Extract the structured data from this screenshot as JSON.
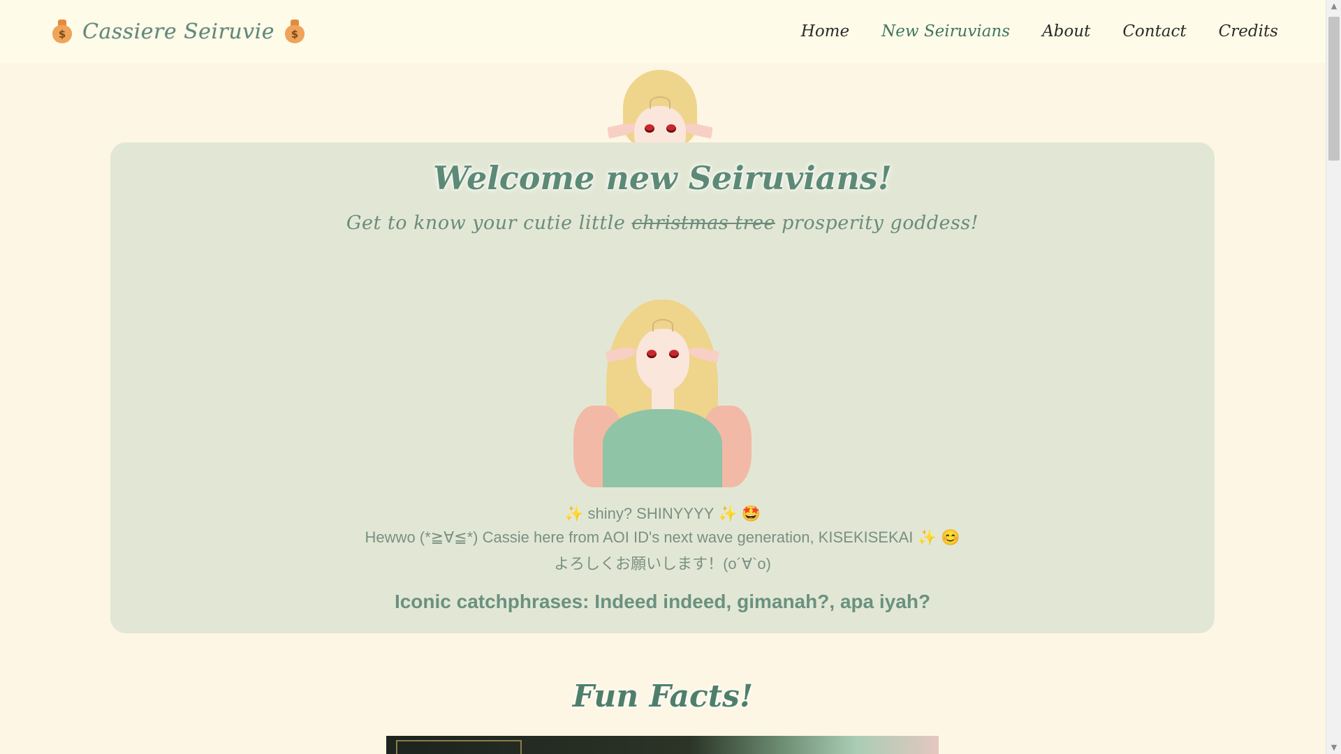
{
  "header": {
    "brand": "Cassiere Seiruvie",
    "brand_icon": "money-bag-icon",
    "nav": [
      {
        "label": "Home",
        "active": false
      },
      {
        "label": "New Seiruvians",
        "active": true
      },
      {
        "label": "About",
        "active": false
      },
      {
        "label": "Contact",
        "active": false
      },
      {
        "label": "Credits",
        "active": false
      }
    ]
  },
  "card": {
    "title": "Welcome new Seiruvians!",
    "subtitle_before": "Get to know your cutie little",
    "subtitle_struck": "christmas tree",
    "subtitle_after": "prosperity goddess!",
    "line1": "✨ shiny? SHINYYYY ✨ 🤩",
    "line2": "Hewwo (*≧∀≦*) Cassie here from AOI ID's next wave generation, KISEKISEKAI ✨ 😊",
    "line3": "よろしくお願いします！(o´∀`o)",
    "catchphrases": "Iconic catchphrases: Indeed indeed, gimanah?, apa iyah?"
  },
  "fun_facts": {
    "title": "Fun Facts!"
  },
  "colors": {
    "background": "#fdf6e4",
    "header_bg": "#fefbe8",
    "card_bg": "#e2e7d5",
    "accent": "#5c8a76",
    "nav_active": "#3f7663"
  }
}
